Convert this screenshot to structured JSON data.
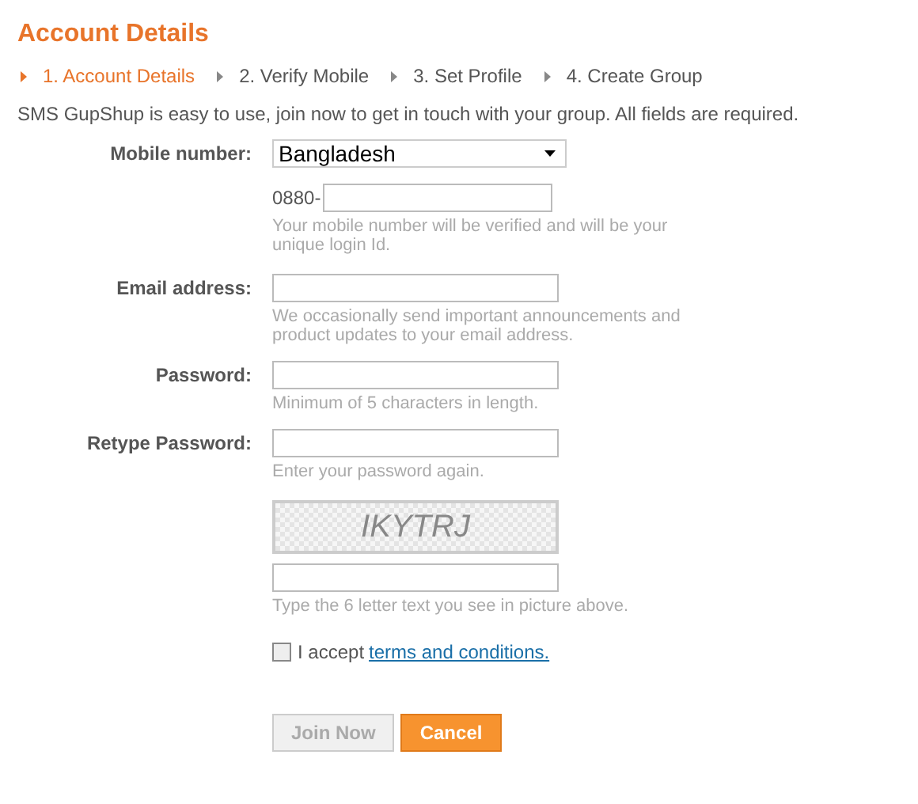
{
  "title": "Account Details",
  "steps": [
    {
      "label": "1. Account Details",
      "selected": true
    },
    {
      "label": "2. Verify Mobile",
      "selected": false
    },
    {
      "label": "3. Set Profile",
      "selected": false
    },
    {
      "label": "4. Create Group",
      "selected": false
    }
  ],
  "intro": "SMS GupShup is easy to use, join now to get in touch with your group. All fields are required.",
  "mobile": {
    "label": "Mobile number:",
    "country": "Bangladesh",
    "prefix": "0880-",
    "help": "Your mobile number will be verified and will be your unique login Id."
  },
  "fields": [
    {
      "label": "Email address:",
      "help": "We occasionally send important announcements and product updates to your email address."
    },
    {
      "label": "Password:",
      "help": "Minimum of 5 characters in length."
    },
    {
      "label": "Retype Password:",
      "help": "Enter your password again."
    }
  ],
  "captcha": {
    "text": "IKYTRJ",
    "help": "Type the 6 letter text you see in picture above."
  },
  "terms": {
    "checked": false,
    "text": "I accept",
    "link": "terms and conditions."
  },
  "buttons": [
    {
      "label": "Join Now",
      "disabled": true
    },
    {
      "label": "Cancel",
      "disabled": false
    }
  ]
}
